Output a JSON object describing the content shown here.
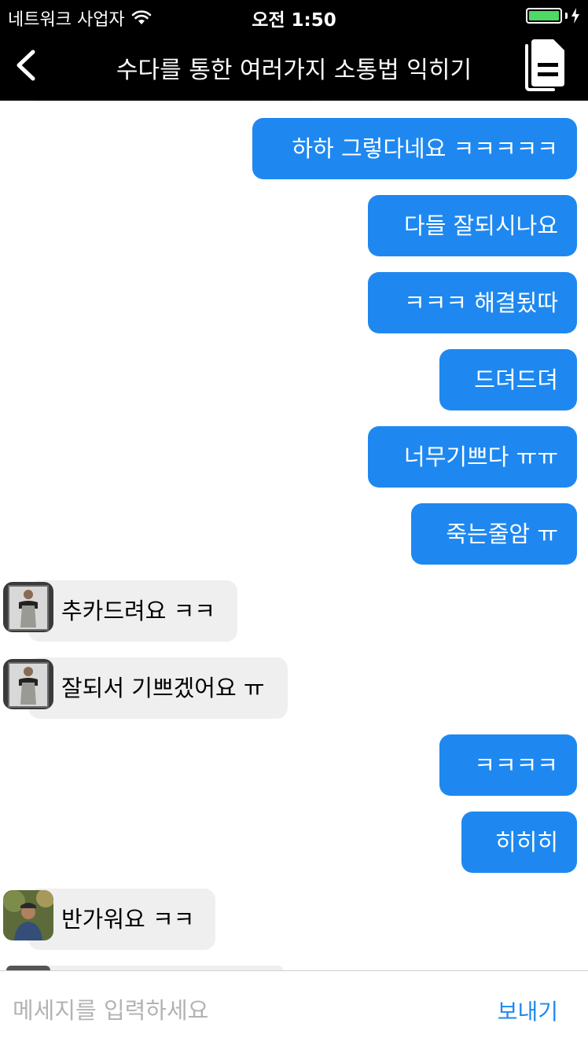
{
  "status_bar": {
    "carrier": "네트워크 사업자",
    "time": "오전 1:50",
    "battery_color": "#4cd964"
  },
  "nav": {
    "back_icon": "chevron-left-icon",
    "title": "수다를 통한 여러가지 소통법 익히기",
    "action_icon": "document-list-icon"
  },
  "messages": [
    {
      "direction": "out",
      "text": "하하 그렇다네요 ㅋㅋㅋㅋㅋ"
    },
    {
      "direction": "out",
      "text": "다들 잘되시나요"
    },
    {
      "direction": "out",
      "text": "ㅋㅋㅋ 해결됬따"
    },
    {
      "direction": "out",
      "text": "드뎌드뎌"
    },
    {
      "direction": "out",
      "text": "너무기쁘다 ㅠㅠ"
    },
    {
      "direction": "out",
      "text": "죽는줄암 ㅠ"
    },
    {
      "direction": "in",
      "text": "추카드려요 ㅋㅋ"
    },
    {
      "direction": "in",
      "text": "잘되서 기쁘겠어요 ㅠ"
    },
    {
      "direction": "out",
      "text": "ㅋㅋㅋㅋ"
    },
    {
      "direction": "out",
      "text": "히히히"
    },
    {
      "direction": "in",
      "text": "반가워요 ㅋㅋ"
    }
  ],
  "composer": {
    "placeholder": "메세지를 입력하세요",
    "send_label": "보내기",
    "accent_color": "#1e88f0"
  }
}
